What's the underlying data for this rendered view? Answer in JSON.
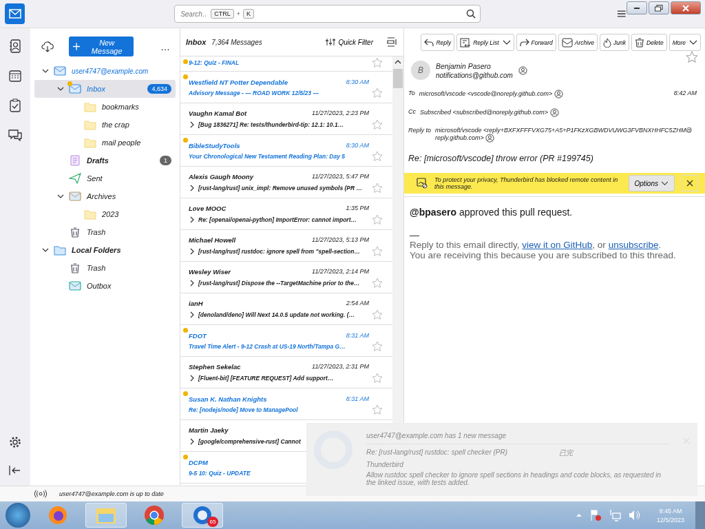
{
  "search": {
    "placeholder": "Search…",
    "keys": [
      "CTRL",
      "K"
    ],
    "key_separator": "+"
  },
  "spaces": [
    {
      "kind": "mail",
      "selected": true
    },
    {
      "kind": "contacts",
      "selected": false
    },
    {
      "kind": "calendar",
      "selected": false
    },
    {
      "kind": "tasks",
      "selected": false
    },
    {
      "kind": "chat",
      "selected": false
    }
  ],
  "folder_pane": {
    "new_message": "New Message",
    "more": "…",
    "tree": [
      {
        "name": "user4747@example.com",
        "kind": "account",
        "selected": false,
        "expanded": true,
        "bold": false,
        "children": [
          {
            "name": "Inbox",
            "kind": "inbox",
            "selected": true,
            "expanded": true,
            "count": "4,634",
            "new_mail": true,
            "children": [
              {
                "name": "bookmarks",
                "kind": "folder",
                "selected": false
              },
              {
                "name": "the crap",
                "kind": "folder",
                "selected": false
              },
              {
                "name": "mail people",
                "kind": "folder",
                "selected": false
              }
            ]
          },
          {
            "name": "Drafts",
            "kind": "drafts",
            "selected": false,
            "count": "1",
            "bold": true
          },
          {
            "name": "Sent",
            "kind": "sent",
            "selected": false
          },
          {
            "name": "Archives",
            "kind": "archive",
            "selected": false,
            "expanded": true,
            "children": [
              {
                "name": "2023",
                "kind": "folder",
                "selected": false
              }
            ]
          },
          {
            "name": "Trash",
            "kind": "trash",
            "selected": false
          }
        ]
      },
      {
        "name": "Local Folders",
        "kind": "local",
        "selected": false,
        "expanded": true,
        "bold": true,
        "children": [
          {
            "name": "Trash",
            "kind": "trash",
            "selected": false
          },
          {
            "name": "Outbox",
            "kind": "outbox",
            "selected": false
          }
        ]
      }
    ]
  },
  "message_list": {
    "folder": "Inbox",
    "count": "7,364 Messages",
    "quick_filter": "Quick Filter",
    "messages": [
      {
        "subject": "9-12: Quiz - FINAL",
        "unread": true,
        "thread": false
      },
      {
        "sender": "Westfield NT Potter Dependable",
        "time": "8:30 AM",
        "subject": "Advisory Message - --- ROAD WORK 12/5/23 ---",
        "unread": true,
        "thread": false
      },
      {
        "sender": "Vaughn Kamal Bot",
        "time": "11/27/2023, 2:23 PM",
        "subject": "[Bug 1836271] Re: tests/thunderbird-tip: 12.1: 10.1…",
        "unread": false,
        "thread": true
      },
      {
        "sender": "BibleStudyTools",
        "time": "8:30 AM",
        "subject": "Your Chronological New Testament Reading Plan: Day 5",
        "unread": true,
        "thread": false
      },
      {
        "sender": "Alexis Gaugh Moony",
        "time": "11/27/2023, 5:47 PM",
        "subject": "[rust-lang/rust] unix_impl: Remove unused symbols (PR …",
        "unread": false,
        "thread": true
      },
      {
        "sender": "Love MOOC",
        "time": "1:35 PM",
        "subject": "Re: [openai/openai-python] ImportError: cannot import…",
        "unread": false,
        "thread": true
      },
      {
        "sender": "Michael Howell",
        "time": "11/27/2023, 5:13 PM",
        "subject": "[rust-lang/rust] rustdoc: ignore spell from \"spell-section…",
        "unread": false,
        "thread": true
      },
      {
        "sender": "Wesley Wiser",
        "time": "11/27/2023, 2:14 PM",
        "subject": "[rust-lang/rust] Dispose the --TargetMachine prior to the…",
        "unread": false,
        "thread": true
      },
      {
        "sender": "ianH",
        "time": "2:54 AM",
        "subject": "[denoland/deno] Will Next 14.0.5 update not working. (…",
        "unread": false,
        "thread": true
      },
      {
        "sender": "FDOT",
        "time": "8:31 AM",
        "subject": "Travel Time Alert - 9-12 Crash at US-19 North/Tampa G…",
        "unread": true,
        "thread": false
      },
      {
        "sender": "Stephen Sekelac",
        "time": "11/27/2023, 2:31 PM",
        "subject": "[Fluent-bit] [FEATURE REQUEST] Add support…",
        "unread": false,
        "thread": true
      },
      {
        "sender": "Susan K. Nathan Knights",
        "time": "8:31 AM",
        "subject": "Re: [nodejs/node] Move to ManagePool",
        "unread": true,
        "thread": false
      },
      {
        "sender": "Martin Jaeky",
        "subject": "[google/comprehensive-rust] Cannot",
        "unread": false,
        "thread": true
      },
      {
        "sender": "DCPM",
        "subject": "9-5 10: Quiz - UPDATE",
        "unread": true,
        "thread": false
      }
    ]
  },
  "reader": {
    "toolbar": [
      {
        "label": "Reply",
        "kind": "reply"
      },
      {
        "label": "Reply List",
        "kind": "reply-list"
      },
      {
        "label": "Forward",
        "kind": "forward"
      },
      {
        "label": "Archive",
        "kind": "archive"
      },
      {
        "label": "Junk",
        "kind": "junk"
      },
      {
        "label": "Delete",
        "kind": "delete"
      },
      {
        "label": "More",
        "kind": "more"
      }
    ],
    "starred": false,
    "from_name": "Benjamin Pasero",
    "from_email": "notifications@github.com",
    "avatar": "B",
    "headers": [
      {
        "label": "To",
        "value": "microsoft/vscode <vscode@noreply.github.com>"
      },
      {
        "label": "Cc",
        "value": "Subscribed <subscribed@noreply.github.com>"
      },
      {
        "label": "Reply to",
        "value": "microsoft/vscode <reply+BXFXFFFVXG75+A5+P1FKzXGBWDVUWG3FVBNXHHFC5ZHM@reply.github.com>"
      }
    ],
    "time": "8:42 AM",
    "subject": "Re: [microsoft/vscode] throw error (PR #199745)",
    "remote_notice": "To protect your privacy, Thunderbird has blocked remote content in this message.",
    "options": "Options",
    "body": [
      {
        "kind": "lead",
        "text": "**@bpasero** approved this pull request."
      },
      {
        "kind": "sig",
        "text": "—"
      }
    ],
    "footer": {
      "before": "Reply to this email directly, ",
      "link1": "view it on GitHub",
      "middle": ", or ",
      "link2": "unsubscribe",
      "after": ".",
      "note": "You are receiving this because you are subscribed to this thread."
    }
  },
  "notification": {
    "title": "user4747@example.com has 1 new message",
    "sender": "Re: [rust-lang/rust] rustdoc: spell checker (PR)",
    "time": "已完",
    "body": "Thunderbird",
    "preview": "Allow rustdoc spell checker to ignore spell sections in headings and code blocks, as requested in the linked issue, with tests added."
  },
  "status_bar": {
    "text": "user4747@example.com is up to date"
  },
  "taskbar": {
    "apps": [
      {
        "kind": "firefox",
        "active": false
      },
      {
        "kind": "explorer",
        "active": true
      },
      {
        "kind": "chrome",
        "active": false
      },
      {
        "kind": "thunderbird",
        "active": true,
        "badge": "65"
      }
    ],
    "time": "9:45 AM",
    "date": "12/5/2023"
  }
}
